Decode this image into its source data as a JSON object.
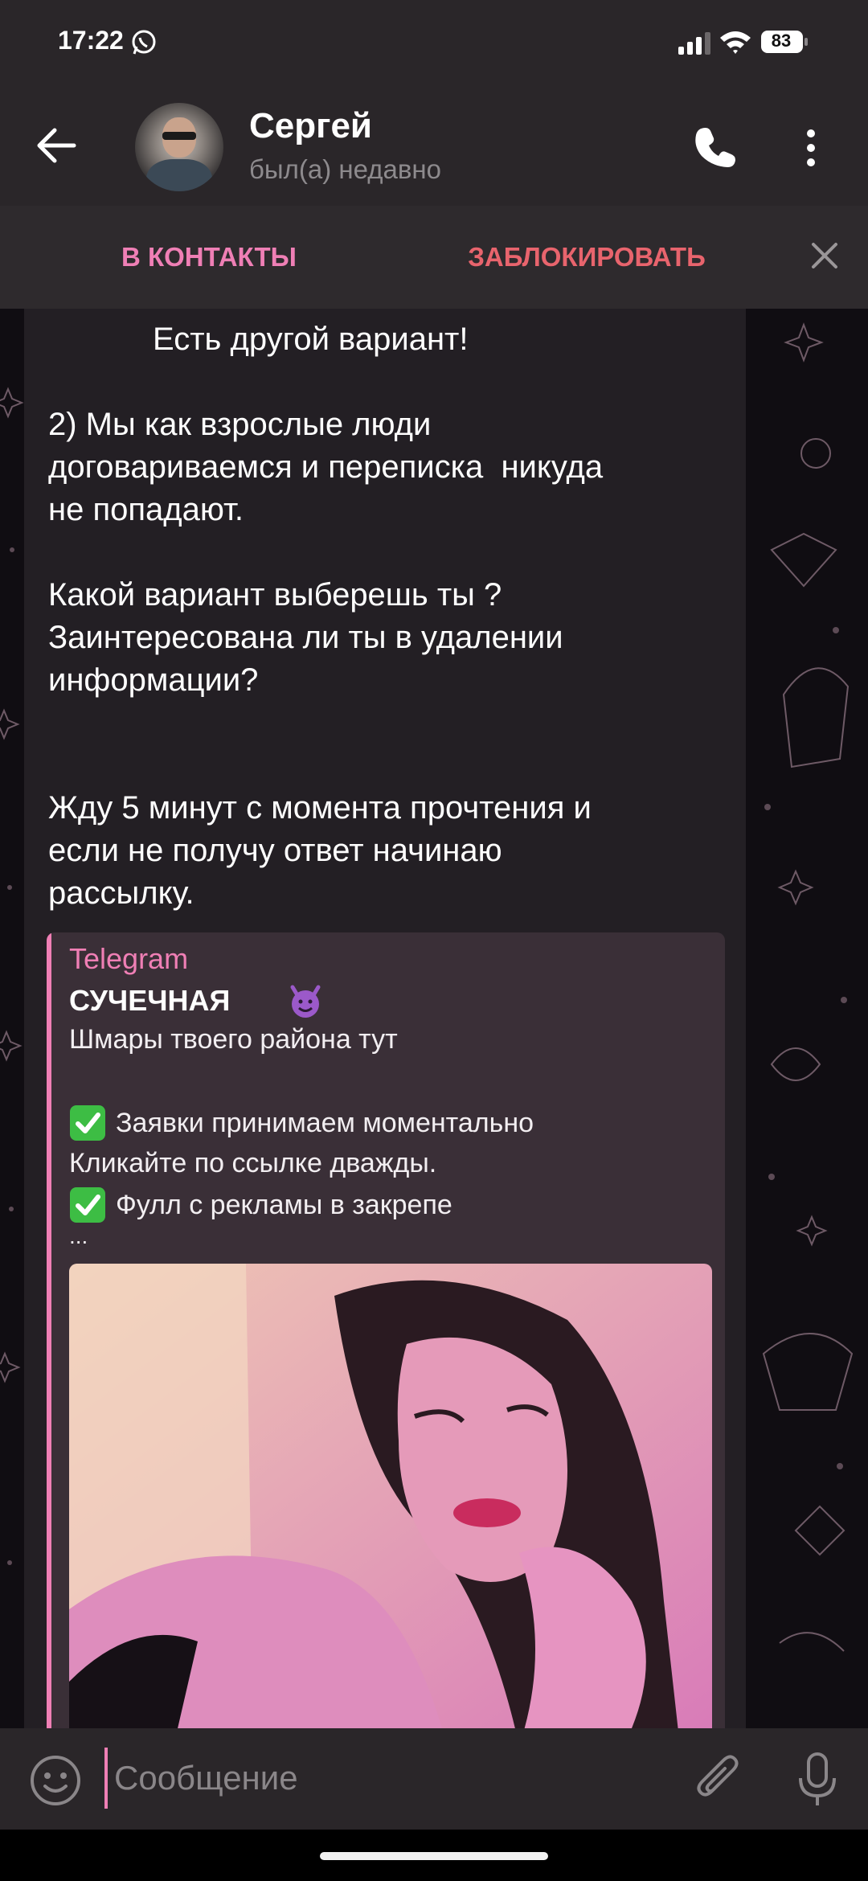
{
  "status_bar": {
    "time": "17:22",
    "battery": "83",
    "icons": [
      "whatsapp-icon",
      "signal-icon",
      "wifi-icon",
      "battery-icon"
    ]
  },
  "header": {
    "name": "Сергей",
    "status": "был(а) недавно",
    "icons": [
      "back-icon",
      "call-icon",
      "more-icon"
    ]
  },
  "action_bar": {
    "add_contact": "В КОНТАКТЫ",
    "block": "ЗАБЛОКИРОВАТЬ",
    "close_icon": "close-icon"
  },
  "message": {
    "line1": "Есть другой вариант!",
    "para2": "2) Мы как взрослые люди\nдоговариваемся и переписка  никуда\nне попадают.",
    "para3": "Какой вариант выберешь ты ?\nЗаинтересована ли ты в удалении\nинформации?",
    "para4": "Жду 5 минут с момента прочтения и\nесли не получу ответ начинаю\nрассылку."
  },
  "link_preview": {
    "site": "Telegram",
    "title": "СУЧЕЧНАЯ",
    "title_emoji": "smiling-devil-icon",
    "line1": "Шмары твоего района тут",
    "line2": "Заявки принимаем моментально",
    "line3": "Кликайте по ссылке дважды.",
    "line4": "Фулл с рекламы в закрепе",
    "ellipsis": "..."
  },
  "input": {
    "placeholder": "Сообщение"
  },
  "colors": {
    "accent_pink": "#ef7fb5",
    "block_red": "#e8646d",
    "bubble": "#231f24",
    "header": "#2a2629"
  }
}
